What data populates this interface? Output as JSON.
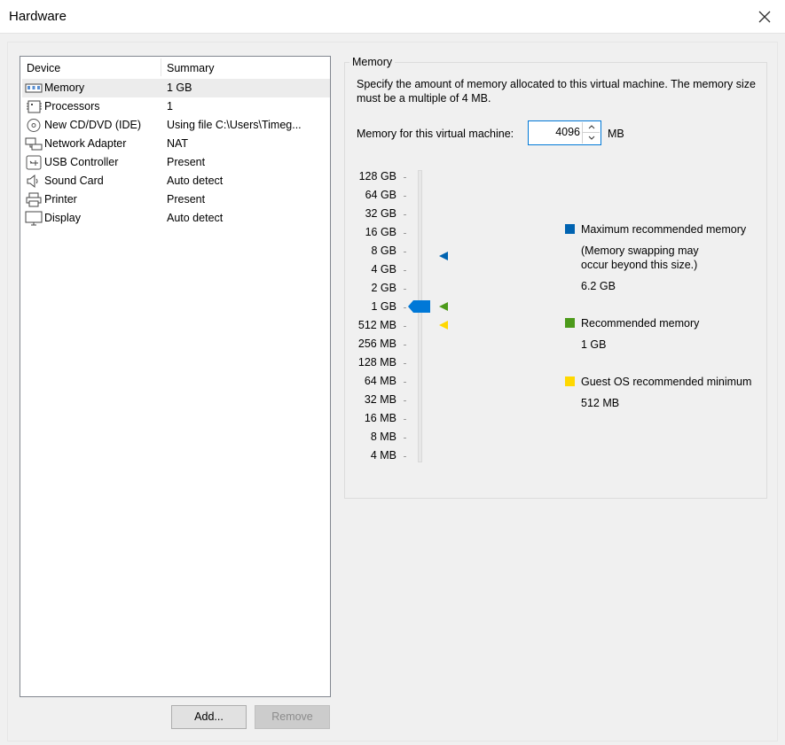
{
  "window": {
    "title": "Hardware"
  },
  "device_list": {
    "headers": {
      "device": "Device",
      "summary": "Summary"
    },
    "items": [
      {
        "name": "Memory",
        "summary": "1 GB",
        "icon": "memory-icon",
        "selected": true
      },
      {
        "name": "Processors",
        "summary": "1",
        "icon": "processor-icon"
      },
      {
        "name": "New CD/DVD (IDE)",
        "summary": "Using file C:\\Users\\Timeg...",
        "icon": "cd-dvd-icon"
      },
      {
        "name": "Network Adapter",
        "summary": "NAT",
        "icon": "network-adapter-icon"
      },
      {
        "name": "USB Controller",
        "summary": "Present",
        "icon": "usb-icon"
      },
      {
        "name": "Sound Card",
        "summary": "Auto detect",
        "icon": "speaker-icon"
      },
      {
        "name": "Printer",
        "summary": "Present",
        "icon": "printer-icon"
      },
      {
        "name": "Display",
        "summary": "Auto detect",
        "icon": "monitor-icon"
      }
    ]
  },
  "buttons": {
    "add": "Add...",
    "remove": "Remove"
  },
  "memory": {
    "group_title": "Memory",
    "description": "Specify the amount of memory allocated to this virtual machine. The memory size must be a multiple of 4 MB.",
    "field_label": "Memory for this virtual machine:",
    "value": "4096",
    "unit": "MB",
    "scale_labels": [
      "128 GB",
      "64 GB",
      "32 GB",
      "16 GB",
      "8 GB",
      "4 GB",
      "2 GB",
      "1 GB",
      "512 MB",
      "256 MB",
      "128 MB",
      "64 MB",
      "32 MB",
      "16 MB",
      "8 MB",
      "4 MB"
    ],
    "slider_position_label": "1 GB",
    "legend": {
      "max": {
        "label": "Maximum recommended memory",
        "note_line1": "(Memory swapping may",
        "note_line2": "occur beyond this size.)",
        "value": "6.2 GB",
        "color": "#0063b1"
      },
      "recommended": {
        "label": "Recommended memory",
        "value": "1 GB",
        "color": "#4c9a1a"
      },
      "guest_min": {
        "label": "Guest OS recommended minimum",
        "value": "512 MB",
        "color": "#ffd800"
      }
    },
    "accent": "#0078d7"
  }
}
